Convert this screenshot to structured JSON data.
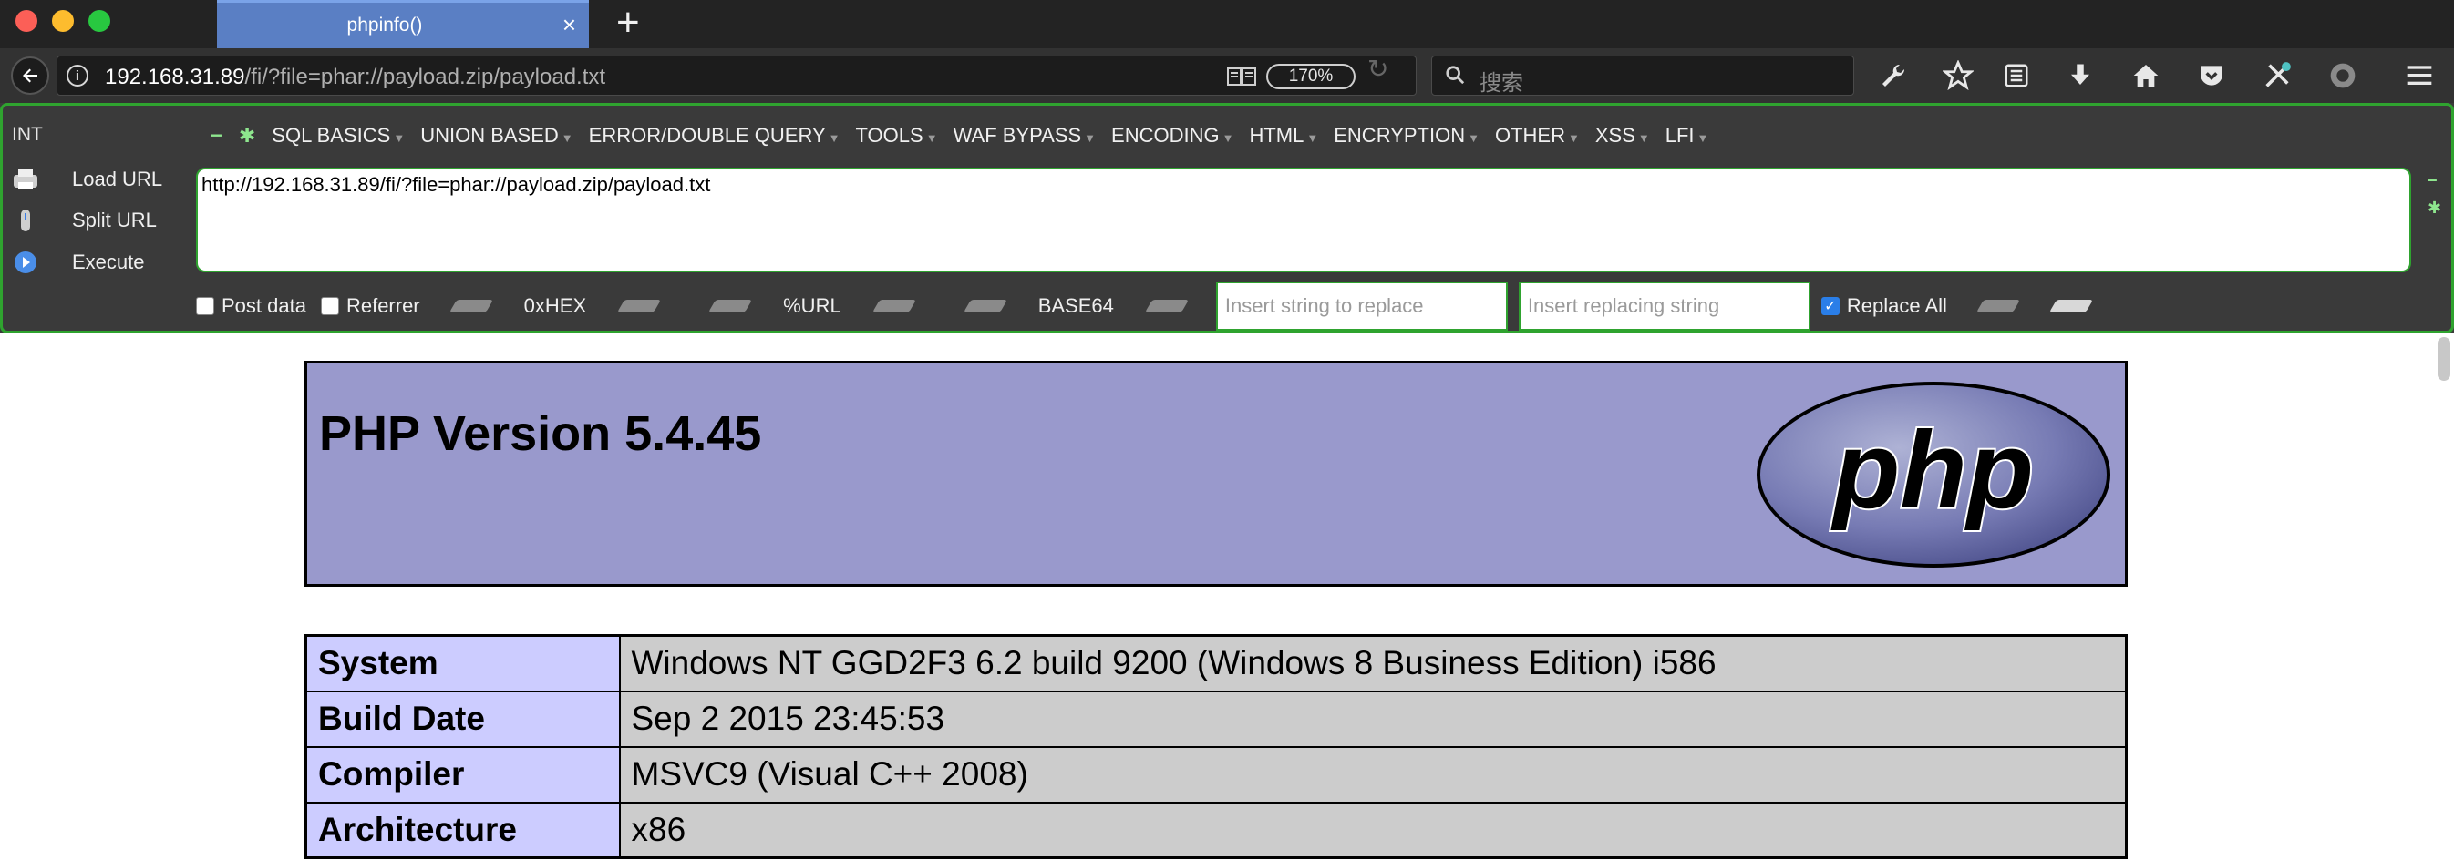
{
  "browser": {
    "tab": {
      "title": "phpinfo()",
      "close": "×"
    },
    "new_tab": "+",
    "url_host": "192.168.31.89",
    "url_path": "/fi/?file=phar://payload.zip/payload.txt",
    "zoom": "170%",
    "search_placeholder": "搜索",
    "toolbar_icons": [
      "wrench-icon",
      "star-icon",
      "reading-list-icon",
      "download-icon",
      "home-icon",
      "pocket-icon",
      "extension-icon",
      "profile-icon",
      "menu-icon"
    ]
  },
  "hackbar": {
    "label": "INT",
    "menu": [
      "SQL BASICS",
      "UNION BASED",
      "ERROR/DOUBLE QUERY",
      "TOOLS",
      "WAF BYPASS",
      "ENCODING",
      "HTML",
      "ENCRYPTION",
      "OTHER",
      "XSS",
      "LFI"
    ],
    "buttons": {
      "load": "Load URL",
      "split": "Split URL",
      "execute": "Execute"
    },
    "url_value": "http://192.168.31.89/fi/?file=phar://payload.zip/payload.txt",
    "post_data": "Post data",
    "referrer": "Referrer",
    "encoders": [
      "0xHEX",
      "%URL",
      "BASE64"
    ],
    "replace_placeholder": "Insert string to replace",
    "replacing_placeholder": "Insert replacing string",
    "replace_all": "Replace All"
  },
  "phpinfo": {
    "title": "PHP Version 5.4.45",
    "logo_text": "php",
    "rows": [
      {
        "key": "System",
        "value": "Windows NT GGD2F3 6.2 build 9200 (Windows 8 Business Edition) i586"
      },
      {
        "key": "Build Date",
        "value": "Sep 2 2015 23:45:53"
      },
      {
        "key": "Compiler",
        "value": "MSVC9 (Visual C++ 2008)"
      },
      {
        "key": "Architecture",
        "value": "x86"
      }
    ]
  },
  "colors": {
    "tab_active": "#5a7fc4",
    "hackbar_border": "#2fa32f",
    "php_header": "#9999cc",
    "php_key_cell": "#ccccff",
    "php_value_cell": "#cccccc"
  }
}
